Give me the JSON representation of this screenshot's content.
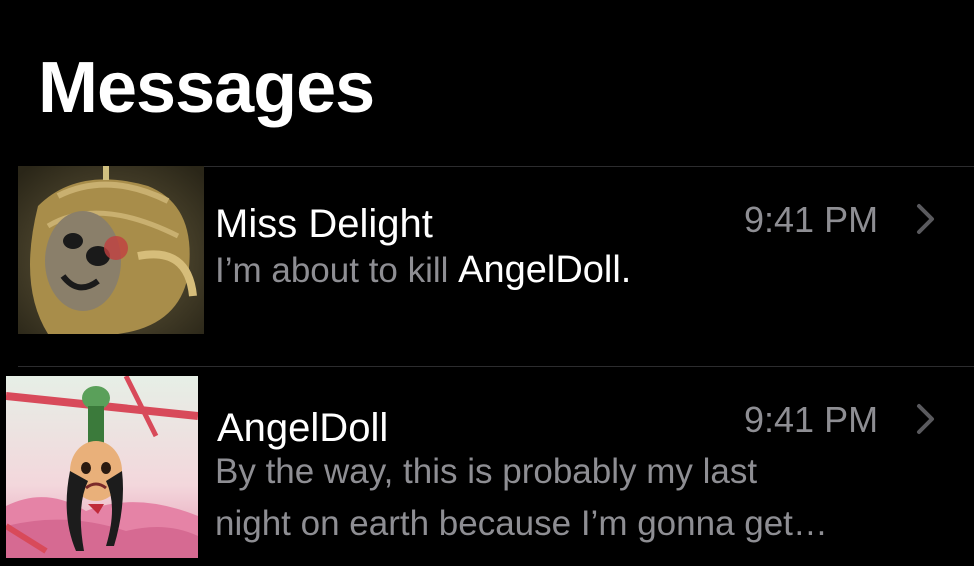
{
  "header": {
    "title": "Messages"
  },
  "conversations": [
    {
      "sender": "Miss Delight",
      "time": "9:41 PM",
      "preview_text": "I’m about to kill ",
      "preview_highlight": "AngelDoll.",
      "avatar_icon": "creepy-doll-portrait"
    },
    {
      "sender": "AngelDoll",
      "time": "9:41 PM",
      "preview_line1": "By the way, this is probably my last",
      "preview_line2": "night on earth because I’m gonna get…",
      "avatar_icon": "upside-down-girl-portrait"
    }
  ],
  "colors": {
    "background": "#000000",
    "primary_text": "#ffffff",
    "secondary_text": "#8e8e93",
    "separator": "#2c2c2e"
  }
}
